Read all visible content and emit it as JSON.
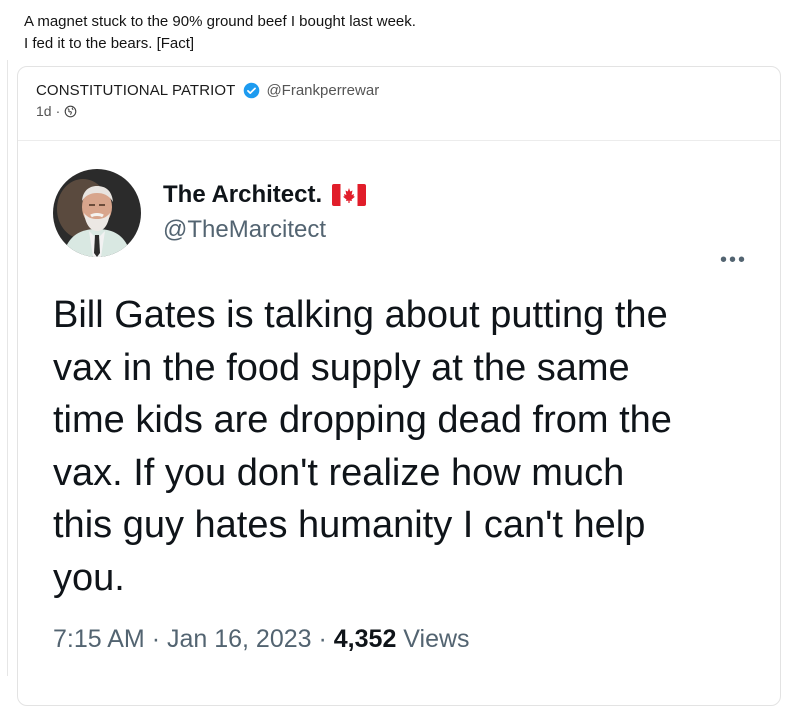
{
  "post": {
    "text_line1": "A magnet stuck to the 90% ground beef I bought last week.",
    "text_line2": "I fed it to the bears. [Fact]"
  },
  "quoted": {
    "author_name": "CONSTITUTIONAL PATRIOT",
    "author_handle": "@Frankperrewar",
    "time_ago": "1d",
    "separator": "·",
    "visibility_icon": "globe-icon",
    "verified_color": "#1d9bf0"
  },
  "tweet_screenshot": {
    "display_name": "The Architect.",
    "flag_icon": "canada-flag-icon",
    "handle": "@TheMarcitect",
    "more_label": "•••",
    "body_lines": [
      "Bill Gates is talking about putting the",
      "vax in the food supply at the same",
      "time kids are dropping dead from the",
      "vax. If you don't realize how much",
      "this guy hates humanity I can't help",
      "you."
    ],
    "time": "7:15 AM",
    "date": "Jan 16, 2023",
    "dot": "·",
    "views_count": "4,352",
    "views_label": "Views"
  }
}
